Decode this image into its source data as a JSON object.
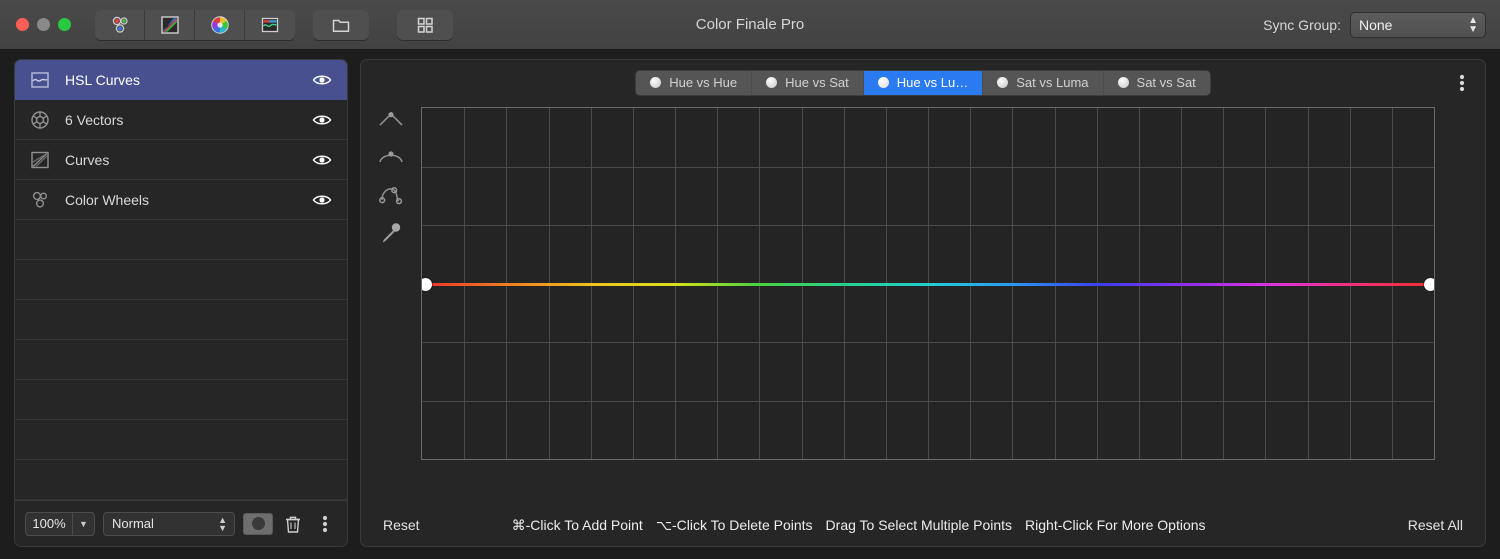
{
  "window": {
    "title": "Color Finale Pro",
    "traffic_lights": [
      "close-button",
      "minimize-button",
      "maximize-button"
    ]
  },
  "toolbar": {
    "segmented": [
      {
        "name": "color-wheels-icon",
        "label": "Color Wheels"
      },
      {
        "name": "curves-icon",
        "label": "Curves"
      },
      {
        "name": "six-vectors-icon",
        "label": "6 Vectors"
      },
      {
        "name": "hsl-curves-icon",
        "label": "HSL Curves"
      }
    ],
    "folder_button": "folder-icon",
    "grid_button": "grid-icon"
  },
  "sync_group": {
    "label": "Sync Group:",
    "value": "None",
    "options": [
      "None"
    ]
  },
  "sidebar": {
    "layers": [
      {
        "name": "HSL Curves",
        "icon": "hsl-curves-icon",
        "selected": true,
        "visible": true
      },
      {
        "name": "6 Vectors",
        "icon": "six-vectors-icon",
        "selected": false,
        "visible": true
      },
      {
        "name": "Curves",
        "icon": "curves-icon",
        "selected": false,
        "visible": true
      },
      {
        "name": "Color Wheels",
        "icon": "color-wheels-icon",
        "selected": false,
        "visible": true
      }
    ],
    "empty_row_count": 7,
    "footer": {
      "opacity": "100%",
      "blend_mode": "Normal",
      "blend_options": [
        "Normal"
      ],
      "mask_button": "mask-icon",
      "delete_button": "trash-icon",
      "more_button": "kebab-icon"
    }
  },
  "main": {
    "tabs": [
      {
        "label": "Hue vs Hue",
        "active": false
      },
      {
        "label": "Hue vs Sat",
        "active": false
      },
      {
        "label": "Hue vs Lu…",
        "active": true
      },
      {
        "label": "Sat vs Luma",
        "active": false
      },
      {
        "label": "Sat vs Sat",
        "active": false
      }
    ],
    "panel_menu": "kebab-icon",
    "tools": [
      {
        "name": "corner-point-icon"
      },
      {
        "name": "smooth-point-icon"
      },
      {
        "name": "bezier-node-icon"
      },
      {
        "name": "eyedropper-icon"
      }
    ],
    "graph": {
      "grid_columns": 24,
      "grid_rows": 6,
      "curve_color_stops": [
        "#f0302a",
        "#f07a22",
        "#efc41e",
        "#d8e01c",
        "#4ad23f",
        "#25d08d",
        "#22cfd0",
        "#2a9bf0",
        "#3a3ff0",
        "#8a2ff0",
        "#e033e0",
        "#f0307a",
        "#f0302a"
      ],
      "control_points": [
        "left-endpoint",
        "right-endpoint"
      ]
    },
    "statusbar": {
      "reset": "Reset",
      "hints": [
        "⌘-Click To Add Point",
        "⌥-Click To Delete Points",
        "Drag To Select Multiple Points",
        "Right-Click For More Options"
      ],
      "reset_all": "Reset All"
    }
  },
  "colors": {
    "accent": "#2a7bf0",
    "selection": "#48508f",
    "panel_bg": "#262626",
    "titlebar_bg": "#474747"
  }
}
